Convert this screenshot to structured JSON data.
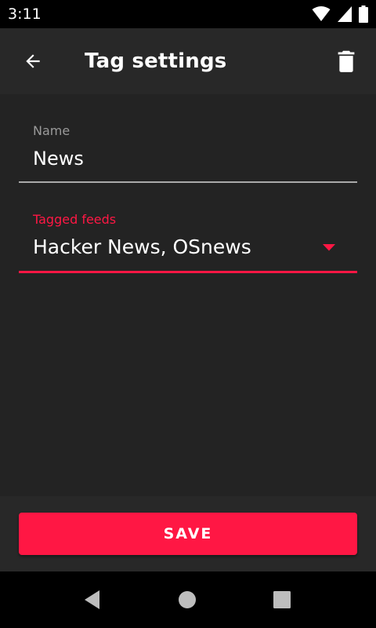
{
  "status_bar": {
    "time": "3:11",
    "icons": [
      "wifi-icon",
      "cell-signal-icon",
      "battery-icon"
    ]
  },
  "app_bar": {
    "title": "Tag settings",
    "back_icon": "arrow-back-icon",
    "delete_icon": "trash-icon"
  },
  "form": {
    "name_field": {
      "label": "Name",
      "value": "News"
    },
    "tagged_feeds_field": {
      "label": "Tagged feeds",
      "value": "Hacker News, OSnews",
      "icon": "dropdown-arrow-icon"
    }
  },
  "actions": {
    "save_label": "SAVE"
  },
  "nav_bar": {
    "icons": [
      "nav-back-icon",
      "nav-home-icon",
      "nav-recents-icon"
    ]
  },
  "colors": {
    "accent": "#ff1744",
    "background": "#232323",
    "app_bar": "#282828",
    "system_bars": "#000000"
  }
}
